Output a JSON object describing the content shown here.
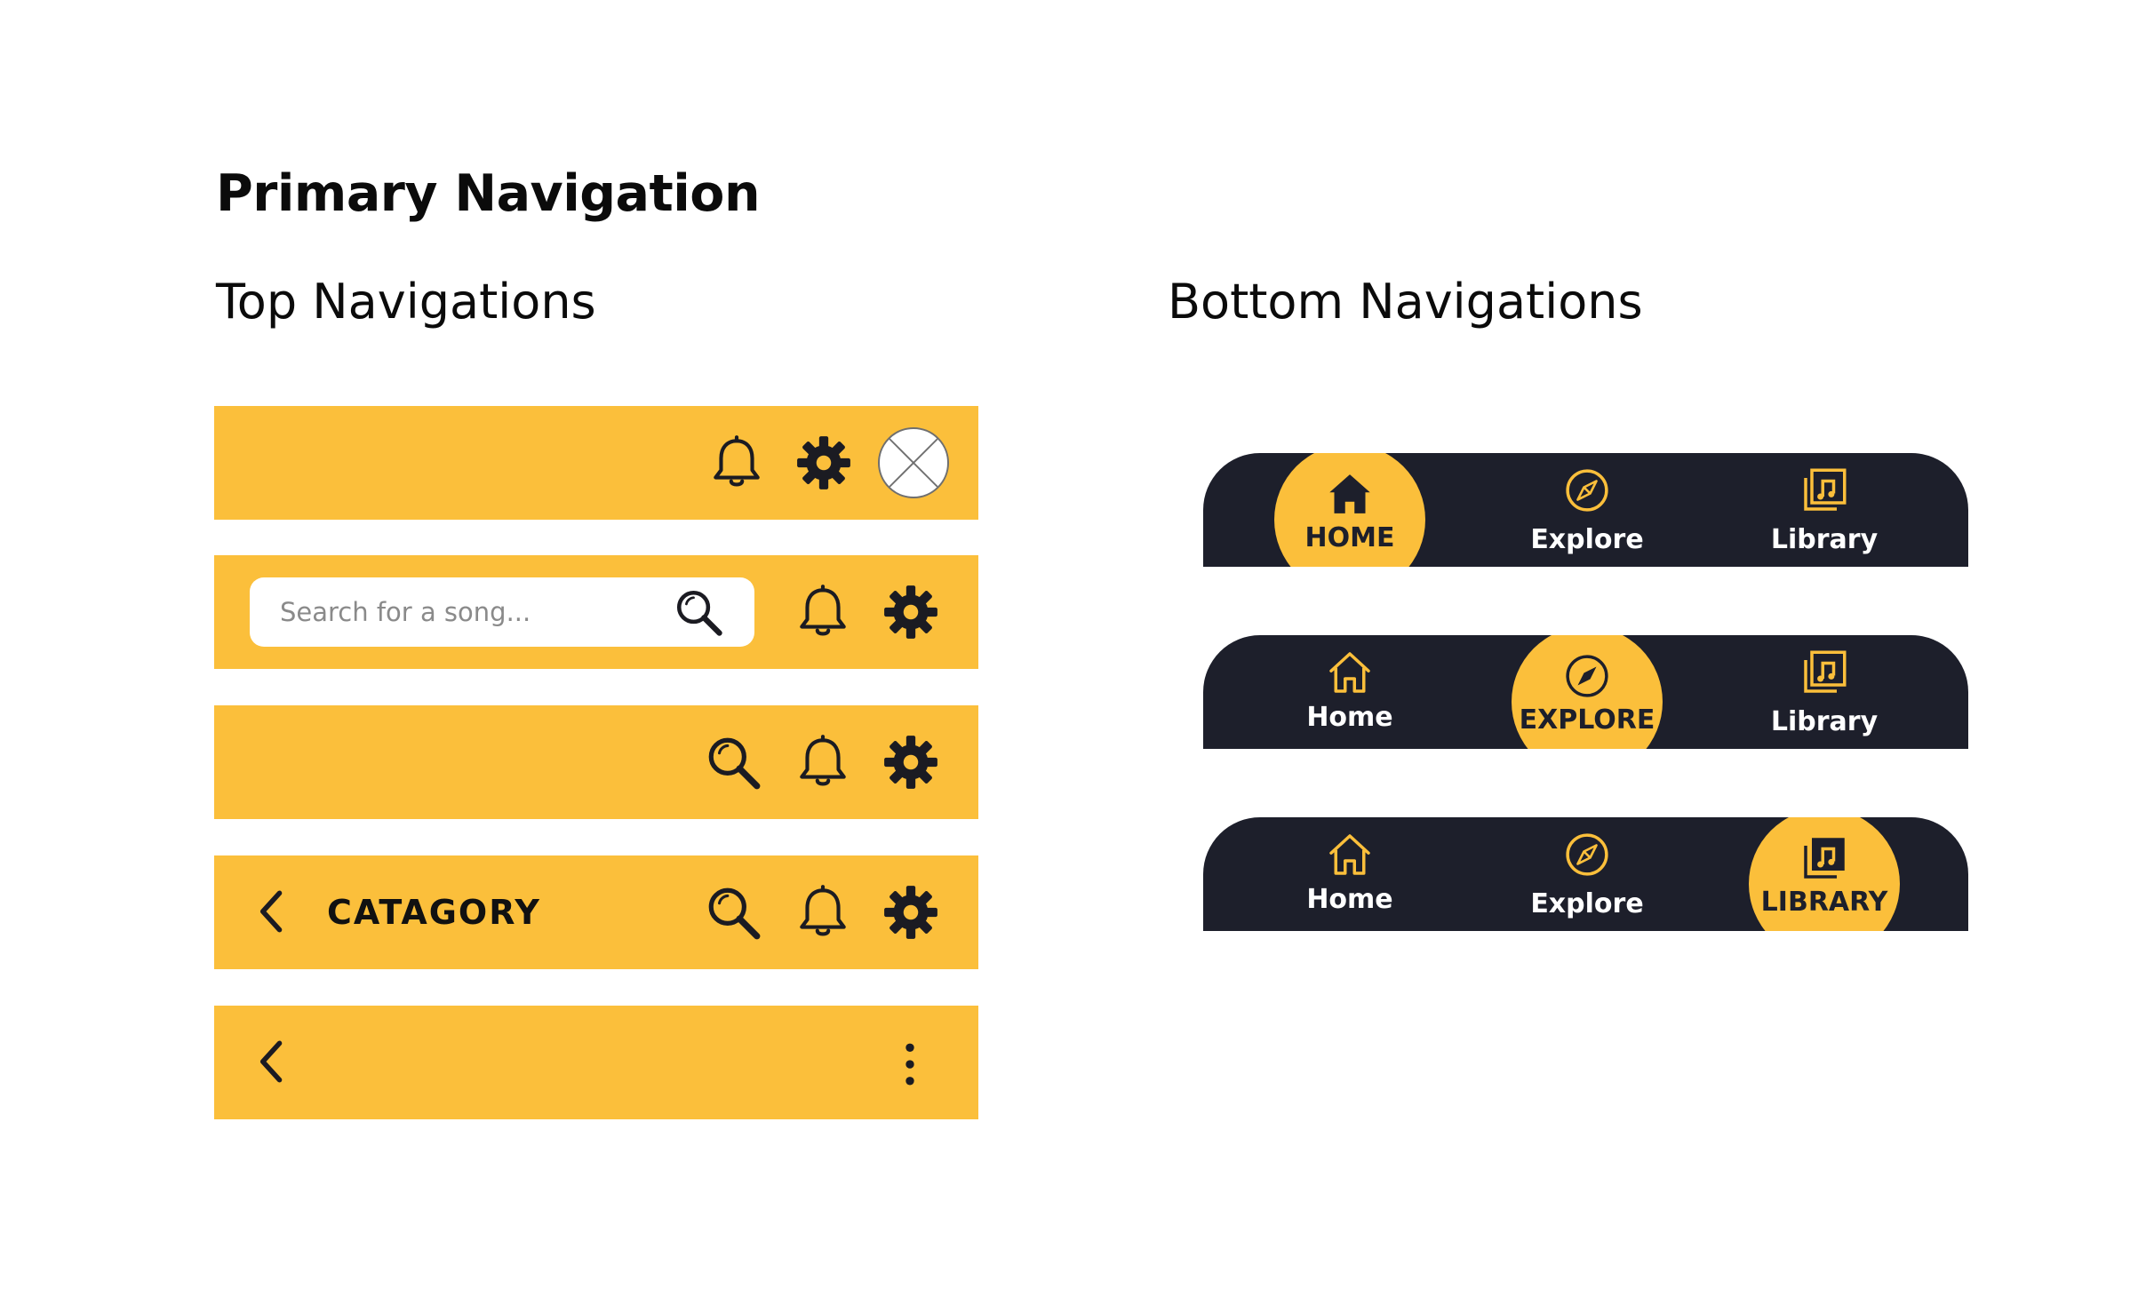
{
  "colors": {
    "accent": "#fbbf3b",
    "dark": "#1d1f2b",
    "icon": "#1b1b22",
    "text": "#0b0b0b"
  },
  "page": {
    "title": "Primary Navigation",
    "top_section_title": "Top Navigations",
    "bottom_section_title": "Bottom Navigations"
  },
  "top_navs": {
    "bar1": {
      "icons": [
        "bell-icon",
        "gear-icon",
        "avatar-placeholder"
      ]
    },
    "bar2": {
      "search_placeholder": "Search for a song...",
      "icons": [
        "search-icon",
        "bell-icon",
        "gear-icon"
      ]
    },
    "bar3": {
      "icons": [
        "search-icon",
        "bell-icon",
        "gear-icon"
      ]
    },
    "bar4": {
      "title": "CATAGORY",
      "icons": [
        "chevron-left-icon",
        "search-icon",
        "bell-icon",
        "gear-icon"
      ]
    },
    "bar5": {
      "icons": [
        "chevron-left-icon",
        "more-vertical-icon"
      ]
    }
  },
  "bottom_navs": {
    "bar1": {
      "active": "home",
      "home_label": "HOME",
      "explore_label": "Explore",
      "library_label": "Library"
    },
    "bar2": {
      "active": "explore",
      "home_label": "Home",
      "explore_label": "EXPLORE",
      "library_label": "Library"
    },
    "bar3": {
      "active": "library",
      "home_label": "Home",
      "explore_label": "Explore",
      "library_label": "LIBRARY"
    }
  }
}
